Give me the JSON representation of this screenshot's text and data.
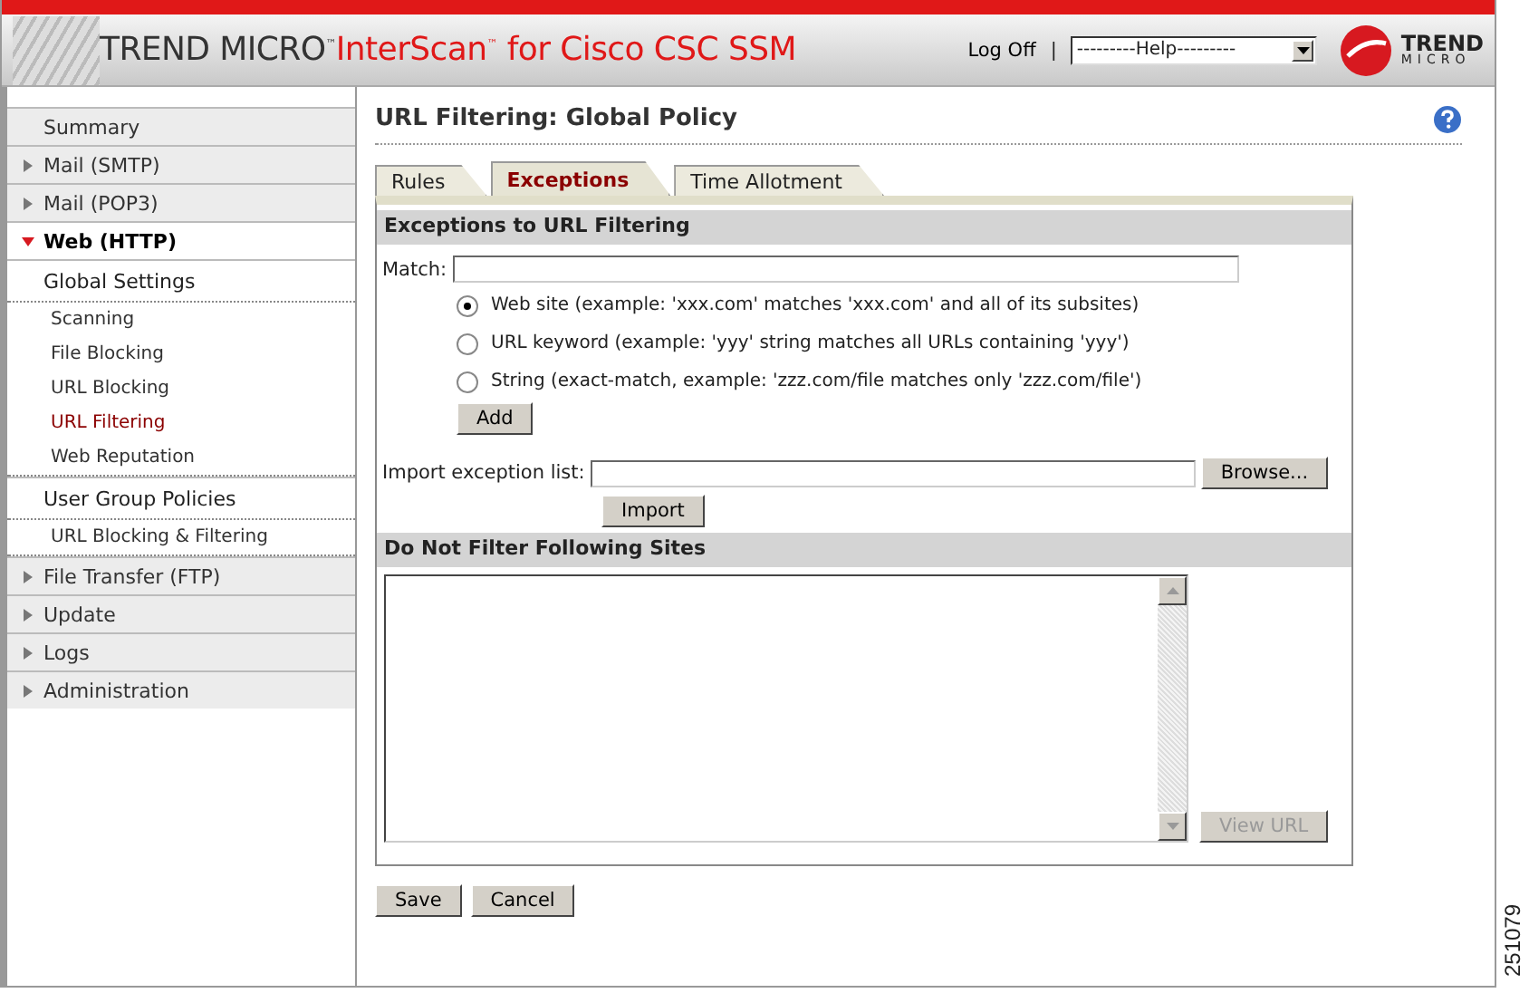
{
  "header": {
    "brand": "TREND MICRO",
    "brand_mark": "™",
    "product": "InterScan",
    "product_mark": "™",
    "product_rest": " for Cisco CSC SSM",
    "logoff": "Log Off",
    "separator": "|",
    "help_select": "---------Help---------",
    "logo_top": "TREND",
    "logo_bottom": "MICRO"
  },
  "sidebar": {
    "items": [
      {
        "label": "Summary",
        "kind": "plain",
        "expanded": false
      },
      {
        "label": "Mail (SMTP)",
        "kind": "section",
        "expanded": false
      },
      {
        "label": "Mail (POP3)",
        "kind": "section",
        "expanded": false
      },
      {
        "label": "Web (HTTP)",
        "kind": "section",
        "expanded": true,
        "children": [
          {
            "label": "Global Settings",
            "kind": "group",
            "children": [
              {
                "label": "Scanning",
                "kind": "sub",
                "selected": false
              },
              {
                "label": "File Blocking",
                "kind": "sub",
                "selected": false
              },
              {
                "label": "URL Blocking",
                "kind": "sub",
                "selected": false
              },
              {
                "label": "URL Filtering",
                "kind": "sub",
                "selected": true
              },
              {
                "label": "Web Reputation",
                "kind": "sub",
                "selected": false
              }
            ]
          },
          {
            "label": "User Group Policies",
            "kind": "group",
            "children": [
              {
                "label": "URL Blocking & Filtering",
                "kind": "sub",
                "selected": false
              }
            ]
          }
        ]
      },
      {
        "label": "File Transfer (FTP)",
        "kind": "section",
        "expanded": false
      },
      {
        "label": "Update",
        "kind": "section",
        "expanded": false
      },
      {
        "label": "Logs",
        "kind": "section",
        "expanded": false
      },
      {
        "label": "Administration",
        "kind": "section",
        "expanded": false
      }
    ]
  },
  "page": {
    "title": "URL Filtering: Global Policy"
  },
  "tabs": [
    {
      "label": "Rules",
      "selected": false
    },
    {
      "label": "Exceptions",
      "selected": true
    },
    {
      "label": "Time Allotment",
      "selected": false
    }
  ],
  "exceptions": {
    "heading": "Exceptions to URL Filtering",
    "match_label": "Match:",
    "options": [
      {
        "label": "Web site (example: 'xxx.com' matches 'xxx.com' and all of its subsites)",
        "selected": true
      },
      {
        "label": "URL keyword (example: 'yyy' string matches all URLs containing 'yyy')",
        "selected": false
      },
      {
        "label": "String (exact-match, example: 'zzz.com/file matches only 'zzz.com/file')",
        "selected": false
      }
    ],
    "add_button": "Add",
    "import_label": "Import exception list:",
    "browse_button": "Browse...",
    "import_button": "Import"
  },
  "sites": {
    "heading": "Do Not Filter Following Sites",
    "view_button": "View URL",
    "view_disabled": true
  },
  "buttons": [
    "Save",
    "Cancel"
  ],
  "figure_number": "251079"
}
